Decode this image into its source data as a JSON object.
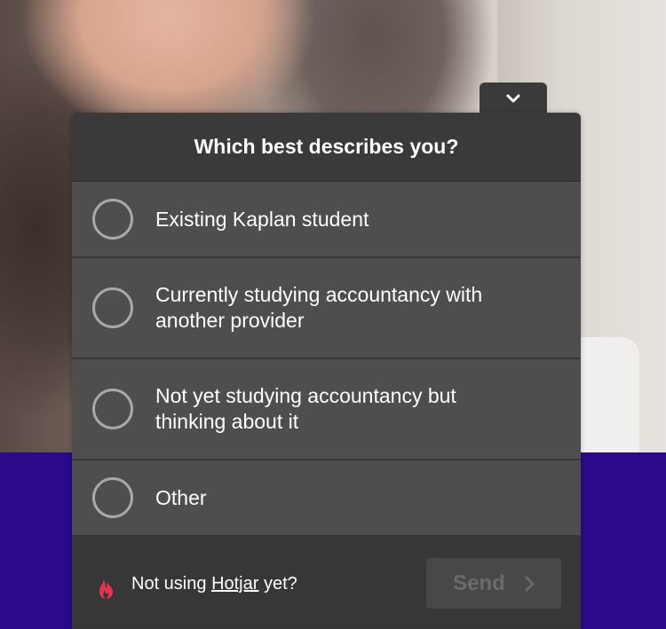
{
  "survey": {
    "question": "Which best describes you?",
    "options": [
      {
        "label": "Existing Kaplan student"
      },
      {
        "label": "Currently studying accountancy with another provider"
      },
      {
        "label": "Not yet studying accountancy but thinking about it"
      },
      {
        "label": "Other"
      }
    ],
    "toggle_icon": "chevron-down-icon"
  },
  "footer": {
    "promo_prefix": "Not using ",
    "promo_link": "Hotjar",
    "promo_suffix": " yet?",
    "logo_icon": "hotjar-flame-icon",
    "send_label": "Send",
    "send_icon": "chevron-right-icon"
  },
  "colors": {
    "widget_background": "#3a3a3a",
    "option_background": "#4e4e4e",
    "band_background": "#2a0a8a",
    "flame_accent": "#e8344e"
  }
}
